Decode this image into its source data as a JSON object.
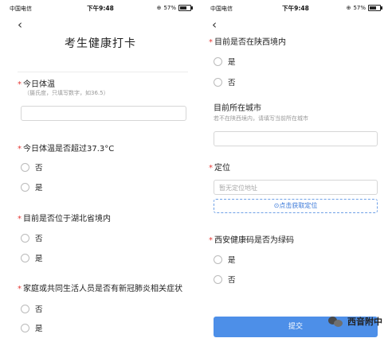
{
  "status_bar": {
    "carrier": "中国电信",
    "time": "下午9:48",
    "battery": "57%",
    "battery_level": 0.57
  },
  "left": {
    "title": "考生健康打卡",
    "q1": {
      "label": "今日体温",
      "hint": "（摄氏度，只填写数字，如36.5）"
    },
    "q2": {
      "label": "今日体温是否超过37.3°C",
      "options": [
        "否",
        "是"
      ]
    },
    "q3": {
      "label": "目前是否位于湖北省境内",
      "options": [
        "否",
        "是"
      ]
    },
    "q4": {
      "label": "家庭或共同生活人员是否有新冠肺炎相关症状",
      "options": [
        "否",
        "是"
      ]
    }
  },
  "right": {
    "q1": {
      "label": "目前是否在陕西境内",
      "options": [
        "是",
        "否"
      ]
    },
    "q2": {
      "label": "目前所在城市",
      "hint": "若不在陕西境内，请填写当前所在城市"
    },
    "q3": {
      "label": "定位",
      "placeholder": "暂无定位地址",
      "locate_label": "⊙点击获取定位"
    },
    "q4": {
      "label": "西安健康码是否为绿码",
      "options": [
        "是",
        "否"
      ]
    },
    "submit_label": "提交"
  },
  "watermark": {
    "text": "西音附中"
  }
}
